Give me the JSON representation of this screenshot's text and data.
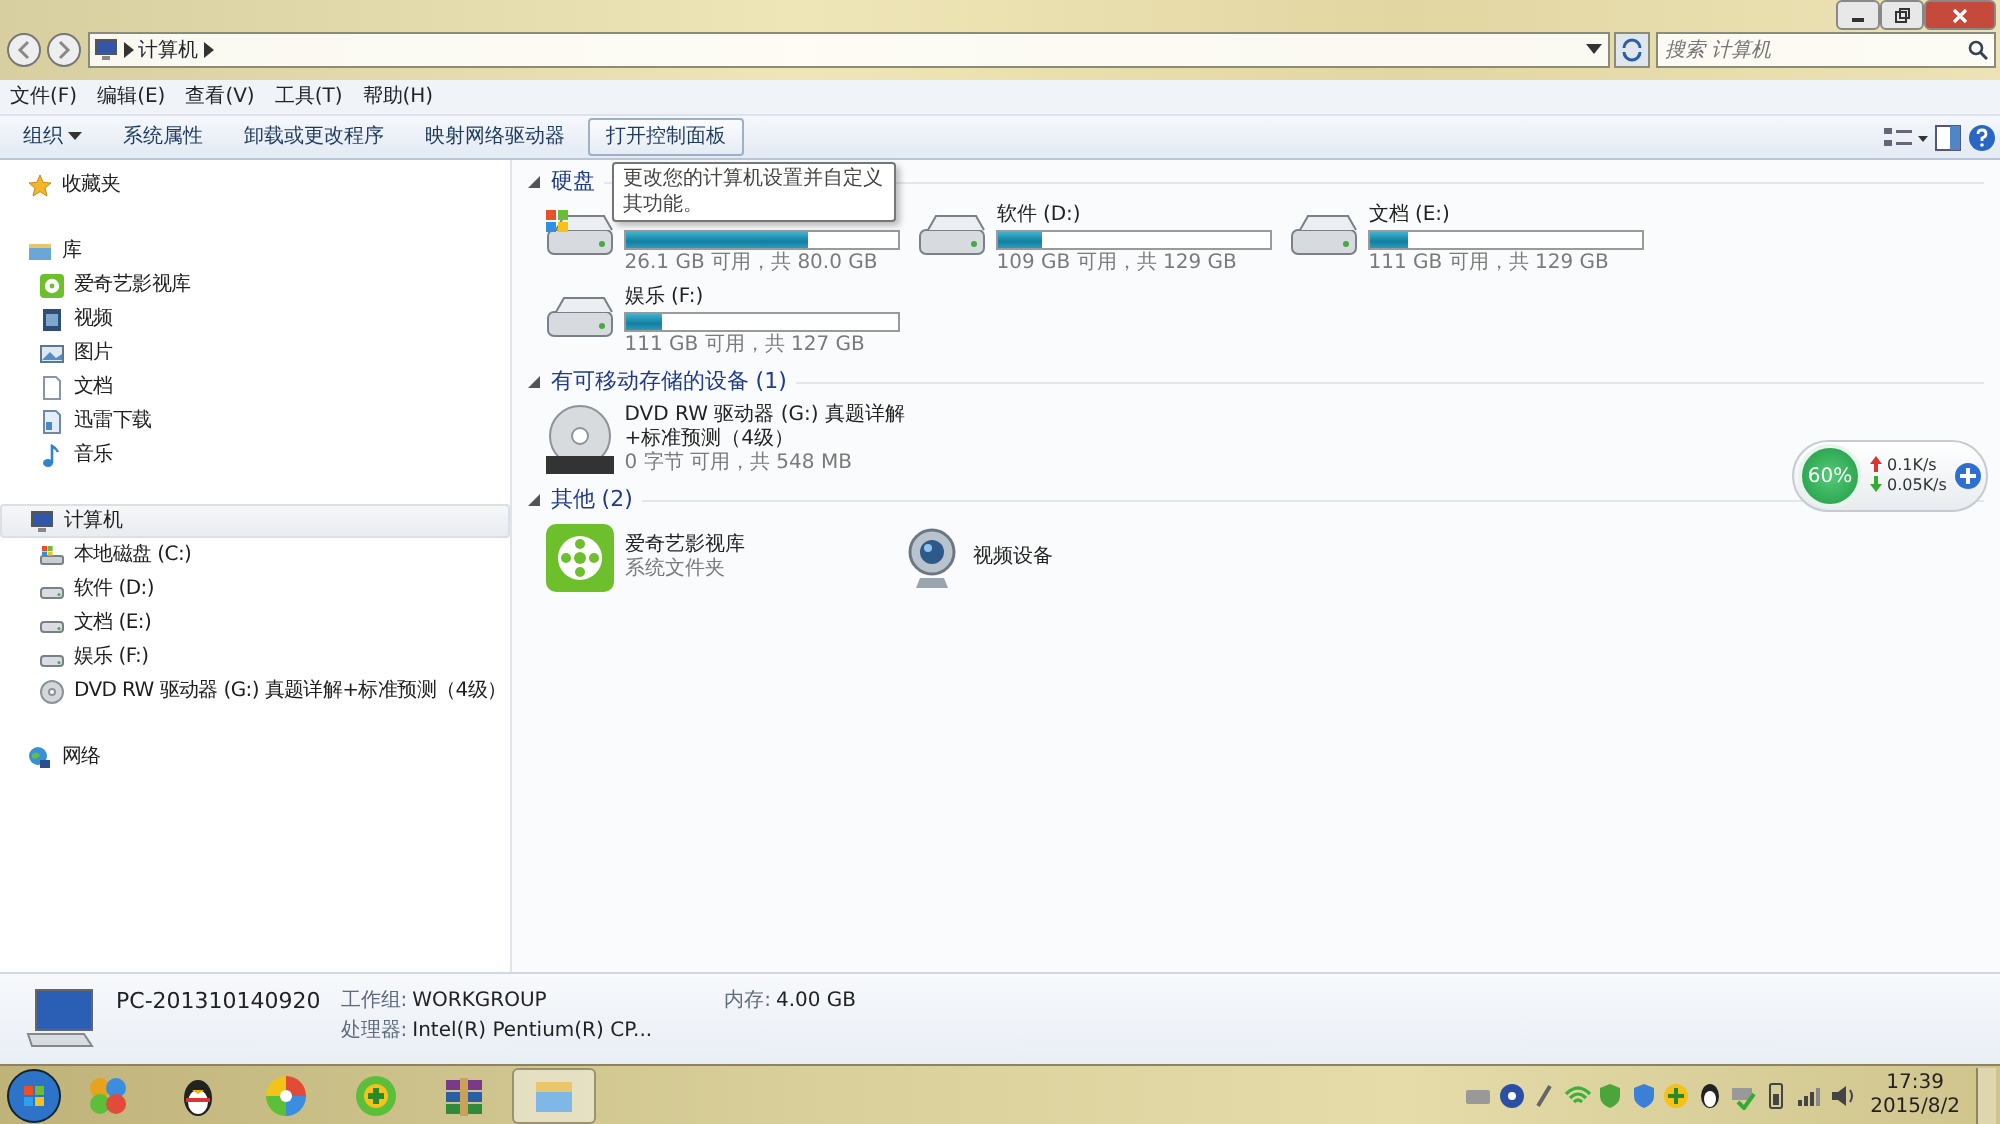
{
  "window": {
    "address": [
      "计算机"
    ],
    "search": {
      "placeholder": "搜索 计算机"
    }
  },
  "menu": [
    "文件(F)",
    "编辑(E)",
    "查看(V)",
    "工具(T)",
    "帮助(H)"
  ],
  "toolbar": [
    {
      "label": "组织",
      "dropdown": true,
      "hovered": false
    },
    {
      "label": "系统属性",
      "dropdown": false,
      "hovered": false
    },
    {
      "label": "卸载或更改程序",
      "dropdown": false,
      "hovered": false
    },
    {
      "label": "映射网络驱动器",
      "dropdown": false,
      "hovered": false
    },
    {
      "label": "打开控制面板",
      "dropdown": false,
      "hovered": true
    }
  ],
  "tooltip": "更改您的计算机设置并自定义其功能。",
  "sidebar": [
    {
      "label": "收藏夹",
      "kind": "favorites",
      "selected": false
    },
    {
      "label": "库",
      "kind": "library",
      "selected": false,
      "children": [
        {
          "label": "爱奇艺影视库",
          "kind": "iqiyi"
        },
        {
          "label": "视频",
          "kind": "video"
        },
        {
          "label": "图片",
          "kind": "picture"
        },
        {
          "label": "文档",
          "kind": "document"
        },
        {
          "label": "迅雷下载",
          "kind": "download"
        },
        {
          "label": "音乐",
          "kind": "music"
        }
      ]
    },
    {
      "label": "计算机",
      "kind": "computer",
      "selected": true,
      "children": [
        {
          "label": "本地磁盘 (C:)",
          "kind": "system-disk"
        },
        {
          "label": "软件 (D:)",
          "kind": "disk"
        },
        {
          "label": "文档 (E:)",
          "kind": "disk"
        },
        {
          "label": "娱乐 (F:)",
          "kind": "disk"
        },
        {
          "label": "DVD RW 驱动器 (G:) 真题详解+标准预测（4级）",
          "kind": "dvd"
        }
      ]
    },
    {
      "label": "网络",
      "kind": "network",
      "selected": false
    }
  ],
  "sections": [
    {
      "title": "硬盘",
      "items": [
        {
          "kind": "system-disk",
          "level": 0.67,
          "detail": "26.1 GB 可用，共 80.0 GB"
        },
        {
          "kind": "disk",
          "name": "软件 (D:)",
          "level": 0.16,
          "detail": "109 GB 可用，共 129 GB"
        },
        {
          "kind": "disk",
          "name": "文档 (E:)",
          "level": 0.14,
          "detail": "111 GB 可用，共 129 GB"
        },
        {
          "kind": "disk",
          "name": "娱乐 (F:)",
          "level": 0.13,
          "detail": "111 GB 可用，共 127 GB"
        }
      ]
    },
    {
      "title": "有可移动存储的设备 (1)",
      "items": [
        {
          "kind": "dvd",
          "name": "DVD RW 驱动器 (G:) 真题详解+标准预测（4级）",
          "detail": "0 字节 可用，共 548 MB"
        }
      ]
    },
    {
      "title": "其他 (2)",
      "items": [
        {
          "kind": "iqiyi",
          "name": "爱奇艺影视库",
          "detail": "系统文件夹"
        },
        {
          "kind": "webcam",
          "name": "视频设备"
        }
      ]
    }
  ],
  "netmeter": {
    "percent": "60%",
    "up": "0.1K/s",
    "down": "0.05K/s"
  },
  "details": {
    "computer": "PC-201310140920",
    "fields": [
      {
        "label": "工作组:",
        "value": "WORKGROUP"
      },
      {
        "label": "内存:",
        "value": "4.00 GB"
      },
      {
        "label": "处理器:",
        "value": "Intel(R) Pentium(R) CP..."
      }
    ]
  },
  "taskbar": {
    "apps": [
      {
        "kind": "circles",
        "selected": false
      },
      {
        "kind": "penguin",
        "selected": false
      },
      {
        "kind": "pinwheel",
        "selected": false
      },
      {
        "kind": "plus",
        "selected": false
      },
      {
        "kind": "archive",
        "selected": false
      },
      {
        "kind": "folder",
        "selected": true
      }
    ],
    "time": "17:39",
    "date": "2015/8/2"
  }
}
